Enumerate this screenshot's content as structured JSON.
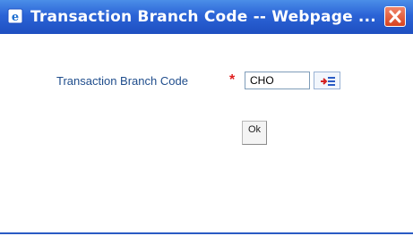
{
  "window": {
    "title": "Transaction Branch Code -- Webpage ...",
    "titlebar_color": "#2b63d6",
    "close_button_color": "#d8431f"
  },
  "form": {
    "field_label": "Transaction Branch Code",
    "required_marker": "*",
    "input_value": "CHO",
    "lov_icon": "list-of-values-icon",
    "ok_label": "Ok"
  }
}
